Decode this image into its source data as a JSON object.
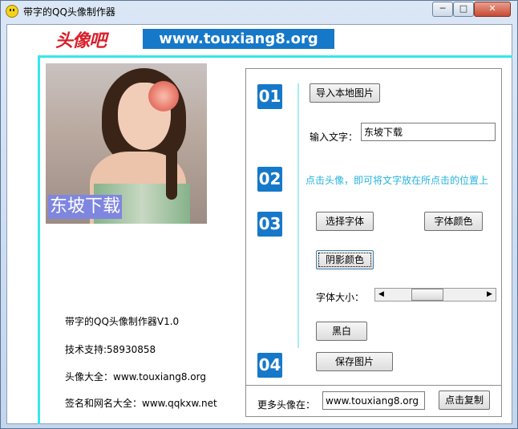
{
  "window": {
    "title": "带字的QQ头像制作器",
    "min_label": "─",
    "max_label": "□",
    "close_label": "✕"
  },
  "header": {
    "logo_text": "头像吧",
    "url": "www.touxiang8.org"
  },
  "avatar": {
    "overlay_text": "东坡下载"
  },
  "info": {
    "version": "带字的QQ头像制作器V1.0",
    "support": "技术支持:58930858",
    "avatars": "头像大全：www.touxiang8.org",
    "signatures": "签名和网名大全：www.qqkxw.net"
  },
  "steps": [
    "01",
    "02",
    "03",
    "04"
  ],
  "panel": {
    "import_button": "导入本地图片",
    "input_label": "输入文字：",
    "input_value": "东坡下载",
    "hint": "点击头像，即可将文字放在所点击的位置上",
    "choose_font_button": "选择字体",
    "font_color_button": "字体颜色",
    "shadow_color_button": "阴影颜色",
    "font_size_label": "字体大小：",
    "font_size_value": 0.38,
    "bw_button": "黑白",
    "save_button": "保存图片",
    "more_label": "更多头像在：",
    "more_url": "www.touxiang8.org",
    "copy_button": "点击复制"
  },
  "colors": {
    "accent_blue": "#1678c9",
    "cyan_line": "#38e6ea",
    "hint_color": "#26b3e0",
    "logo_red": "#d8202a"
  }
}
